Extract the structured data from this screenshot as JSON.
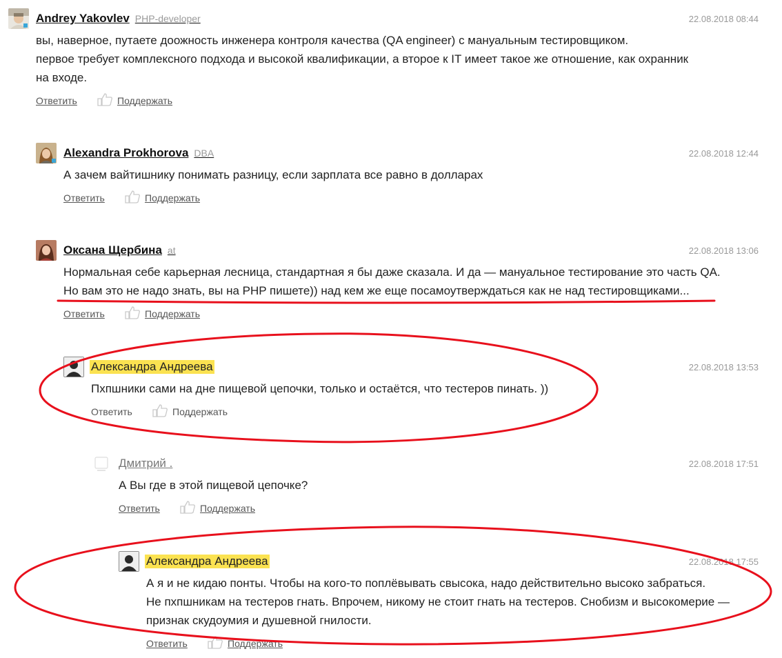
{
  "common": {
    "reply_label": "Ответить",
    "support_label": "Поддержать"
  },
  "comments": [
    {
      "author": "Andrey Yakovlev",
      "position": "PHP-developer",
      "datetime": "22.08.2018 08:44",
      "lines": [
        "вы, наверное, путаете доожность инженера контроля качества (QA engineer) с мануальным тестировщиком.",
        "первое требует комплексного подхода и высокой квалификации, а второе к IT имеет такое же отношение, как охранник",
        "на входе."
      ]
    },
    {
      "author": "Alexandra Prokhorova",
      "position": "DBA",
      "datetime": "22.08.2018 12:44",
      "lines": [
        "А зачем вайтишнику понимать разницу, если зарплата все равно в долларах"
      ]
    },
    {
      "author": "Оксана Щербина",
      "position": "at",
      "datetime": "22.08.2018 13:06",
      "lines": [
        "Нормальная себе карьерная лесница, стандартная я бы даже сказала. И да — мануальное тестирование это часть QA.",
        "Но вам это не надо знать, вы на PHP пишете)) над кем же еще посамоутверждаться как не над тестировщиками..."
      ]
    },
    {
      "author": "Александра Андреева",
      "datetime": "22.08.2018 13:53",
      "lines": [
        "Пхпшники сами на дне пищевой цепочки, только и остаётся, что тестеров пинать. ))"
      ]
    },
    {
      "author": "Дмитрий .",
      "datetime": "22.08.2018 17:51",
      "lines": [
        "А Вы где в этой пищевой цепочке?"
      ]
    },
    {
      "author": "Александра Андреева",
      "datetime": "22.08.2018 17:55",
      "lines": [
        "А я и не кидаю понты. Чтобы на кого-то поплёвывать свысока, надо действительно высоко забраться.",
        "Не пхпшникам на тестеров гнать. Впрочем, никому не стоит гнать на тестеров. Снобизм и высокомерие —",
        "признак скудоумия и душевной гнилости."
      ]
    }
  ],
  "colors": {
    "highlight": "#fbe251",
    "annotation_red": "#e8101c",
    "meta_grey": "#999999"
  },
  "icons": {
    "like": "thumbs-up-icon",
    "avatar": "user-avatar"
  }
}
